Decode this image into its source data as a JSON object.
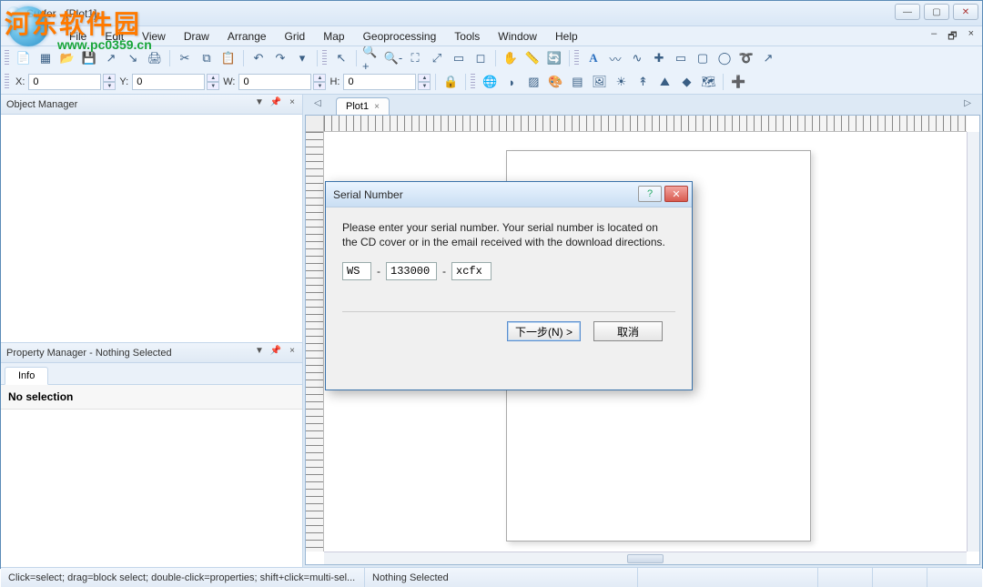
{
  "window": {
    "title": "Surfer - [Plot1]"
  },
  "watermark": {
    "text": "河东软件园",
    "url": "www.pc0359.cn"
  },
  "menu": [
    "File",
    "Edit",
    "View",
    "Draw",
    "Arrange",
    "Grid",
    "Map",
    "Geoprocessing",
    "Tools",
    "Window",
    "Help"
  ],
  "coords": {
    "x_label": "X:",
    "x_val": "0",
    "y_label": "Y:",
    "y_val": "0",
    "w_label": "W:",
    "w_val": "0",
    "h_label": "H:",
    "h_val": "0"
  },
  "panels": {
    "object_manager": "Object Manager",
    "property_manager": "Property Manager - Nothing Selected",
    "prop_tab": "Info",
    "no_selection": "No selection"
  },
  "doc_tab": "Plot1",
  "status": {
    "hint": "Click=select; drag=block select; double-click=properties; shift+click=multi-sel...",
    "selection": "Nothing Selected"
  },
  "dialog": {
    "title": "Serial Number",
    "body": "Please enter your serial number.  Your serial number is located on the CD cover or in the email received with the download directions.",
    "serial": {
      "p1": "WS",
      "p2": "133000",
      "p3": "xcfx",
      "sep": "-"
    },
    "next": "下一步(N) >",
    "cancel": "取消"
  }
}
